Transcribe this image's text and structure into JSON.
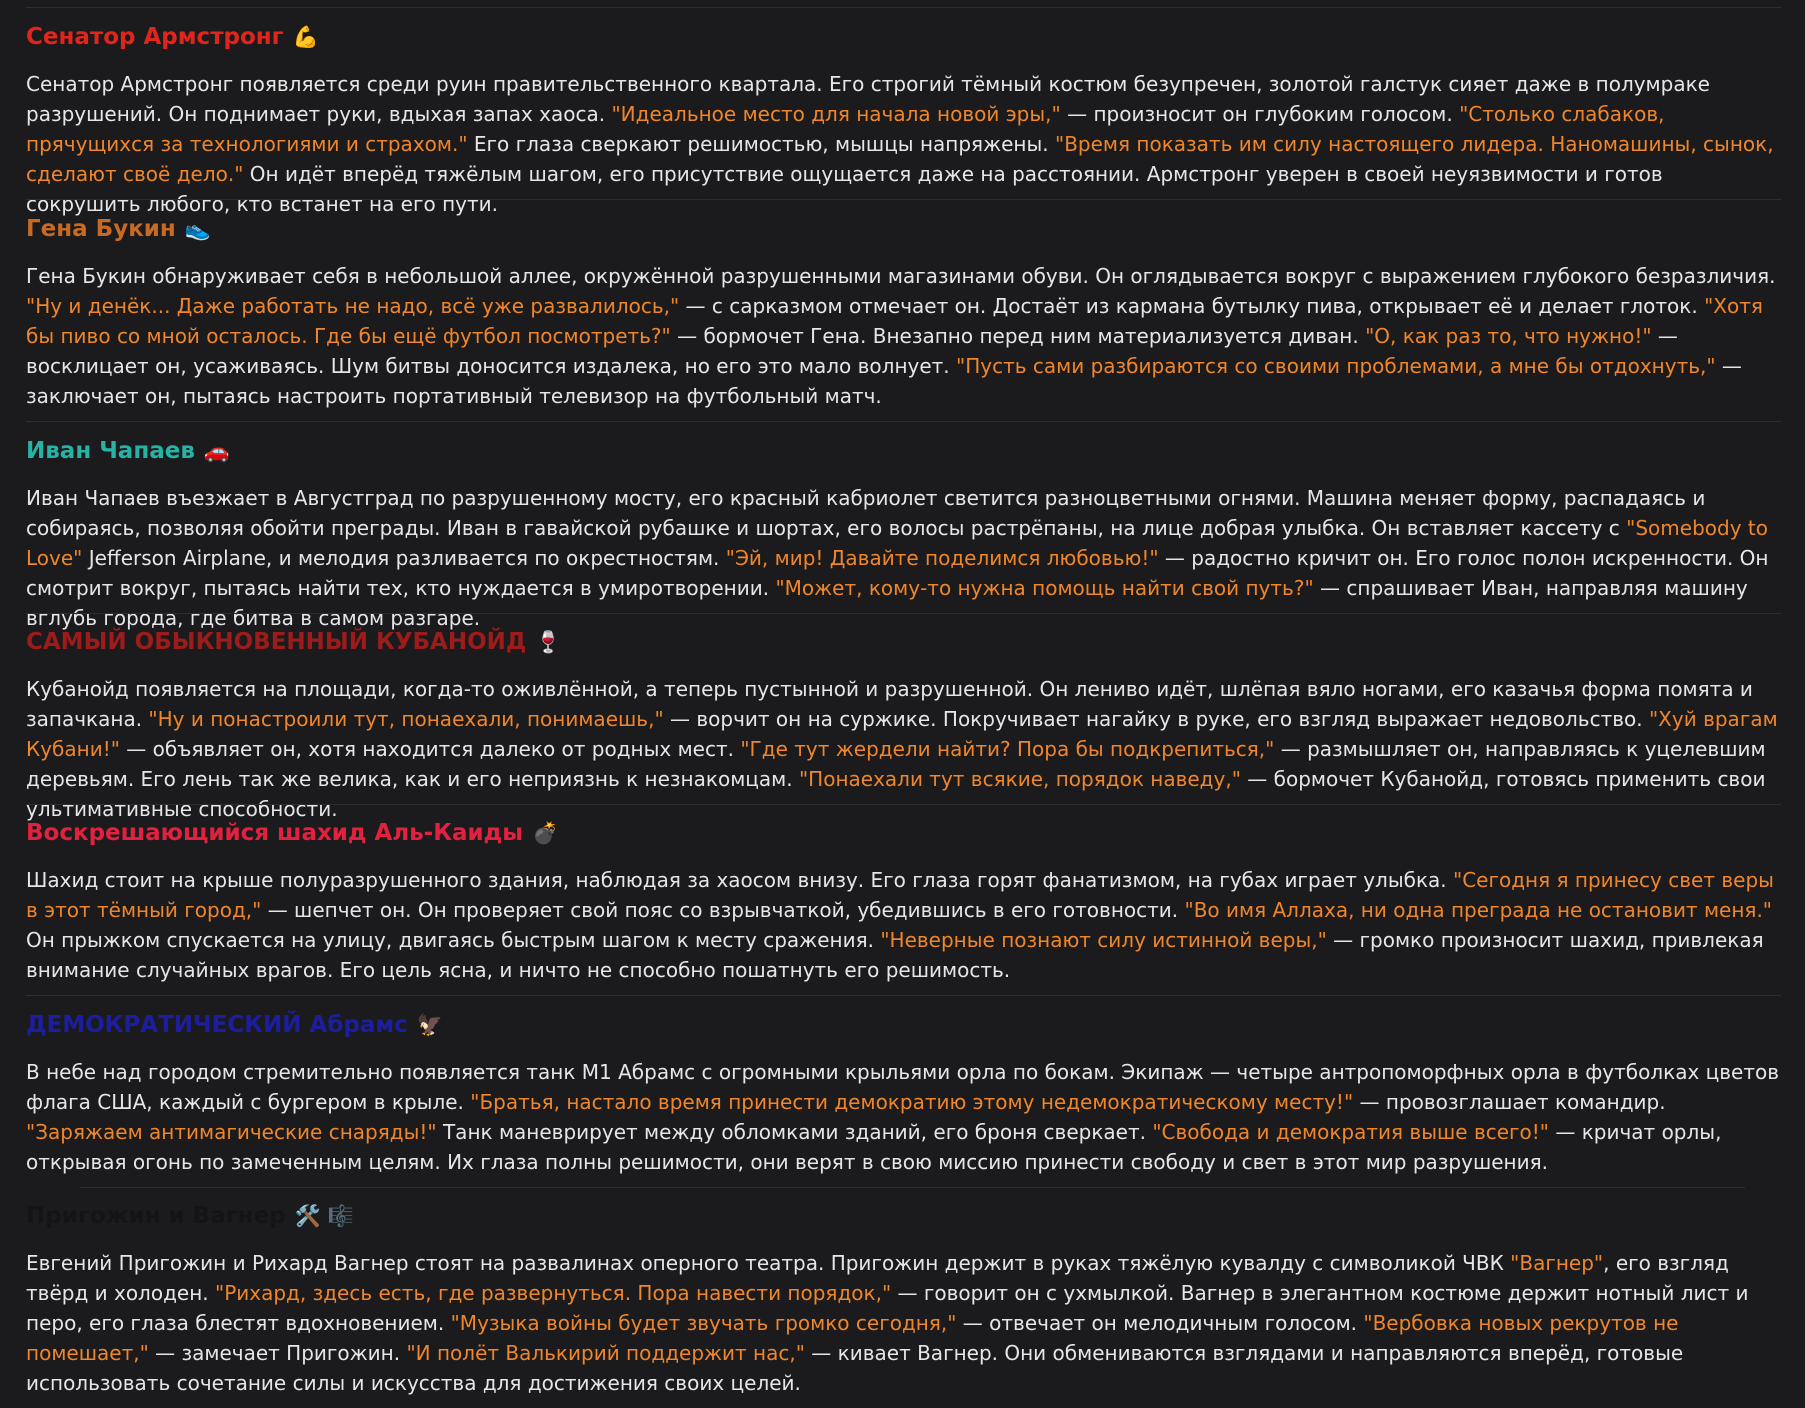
{
  "entries": [
    {
      "name": "Сенатор Армстронг",
      "emoji": "💪",
      "color": "#e0261c",
      "segments": [
        {
          "t": "Сенатор Армстронг появляется среди руин правительственного квартала. Его строгий тёмный костюм безупречен, золотой галстук сияет даже в полумраке разрушений. Он поднимает руки, вдыхая запах хаоса. "
        },
        {
          "t": "\"Идеальное место для начала новой эры,\"",
          "q": true
        },
        {
          "t": " — произносит он глубоким голосом. "
        },
        {
          "t": "\"Столько слабаков, прячущихся за технологиями и страхом.\"",
          "q": true
        },
        {
          "t": " Его глаза сверкают решимостью, мышцы напряжены. "
        },
        {
          "t": "\"Время показать им силу настоящего лидера. Наномашины, сынок, сделают своё дело.\"",
          "q": true
        },
        {
          "t": " Он идёт вперёд тяжёлым шагом, его присутствие ощущается даже на расстоянии. Армстронг уверен в своей неуязвимости и готов сокрушить любого, кто встанет на его пути."
        }
      ]
    },
    {
      "name": "Гена Букин",
      "emoji": "👟",
      "color": "#c66a24",
      "segments": [
        {
          "t": "Гена Букин обнаруживает себя в небольшой аллее, окружённой разрушенными магазинами обуви. Он оглядывается вокруг с выражением глубокого безразличия. "
        },
        {
          "t": "\"Ну и денёк... Даже работать не надо, всё уже развалилось,\"",
          "q": true
        },
        {
          "t": " — с сарказмом отмечает он. Достаёт из кармана бутылку пива, открывает её и делает глоток. "
        },
        {
          "t": "\"Хотя бы пиво со мной осталось. Где бы ещё футбол посмотреть?\"",
          "q": true
        },
        {
          "t": " — бормочет Гена. Внезапно перед ним материализуется диван. "
        },
        {
          "t": "\"О, как раз то, что нужно!\"",
          "q": true
        },
        {
          "t": " — восклицает он, усаживаясь. Шум битвы доносится издалека, но его это мало волнует. "
        },
        {
          "t": "\"Пусть сами разбираются со своими проблемами, а мне бы отдохнуть,\"",
          "q": true
        },
        {
          "t": " — заключает он, пытаясь настроить портативный телевизор на футбольный матч."
        }
      ]
    },
    {
      "name": "Иван Чапаев",
      "emoji": "🚗",
      "color": "#27b2a6",
      "segments": [
        {
          "t": "Иван Чапаев въезжает в Августград по разрушенному мосту, его красный кабриолет светится разноцветными огнями. Машина меняет форму, распадаясь и собираясь, позволяя обойти преграды. Иван в гавайской рубашке и шортах, его волосы растрёпаны, на лице добрая улыбка. Он вставляет кассету с "
        },
        {
          "t": "\"Somebody to Love\"",
          "q": true
        },
        {
          "t": " Jefferson Airplane, и мелодия разливается по окрестностям. "
        },
        {
          "t": "\"Эй, мир! Давайте поделимся любовью!\"",
          "q": true
        },
        {
          "t": " — радостно кричит он. Его голос полон искренности. Он смотрит вокруг, пытаясь найти тех, кто нуждается в умиротворении. "
        },
        {
          "t": "\"Может, кому-то нужна помощь найти свой путь?\"",
          "q": true
        },
        {
          "t": " — спрашивает Иван, направляя машину вглубь города, где битва в самом разгаре."
        }
      ]
    },
    {
      "name": "САМЫЙ ОБЫКНОВЕННЫЙ КУБАНОЙД",
      "emoji": "🍷",
      "color": "#9c1b1b",
      "segments": [
        {
          "t": "Кубанойд появляется на площади, когда-то оживлённой, а теперь пустынной и разрушенной. Он лениво идёт, шлёпая вяло ногами, его казачья форма помята и запачкана. "
        },
        {
          "t": "\"Ну и понастроили тут, понаехали, понимаешь,\"",
          "q": true
        },
        {
          "t": " — ворчит он на суржике. Покручивает нагайку в руке, его взгляд выражает недовольство. "
        },
        {
          "t": "\"Хуй врагам Кубани!\"",
          "q": true
        },
        {
          "t": " — объявляет он, хотя находится далеко от родных мест. "
        },
        {
          "t": "\"Где тут жердели найти? Пора бы подкрепиться,\"",
          "q": true
        },
        {
          "t": " — размышляет он, направляясь к уцелевшим деревьям. Его лень так же велика, как и его неприязнь к незнакомцам. "
        },
        {
          "t": "\"Понаехали тут всякие, порядок наведу,\"",
          "q": true
        },
        {
          "t": " — бормочет Кубанойд, готовясь применить свои ультимативные способности."
        }
      ]
    },
    {
      "name": "Воскрешающийся шахид Аль-Каиды",
      "emoji": "💣",
      "color": "#e3213f",
      "segments": [
        {
          "t": "Шахид стоит на крыше полуразрушенного здания, наблюдая за хаосом внизу. Его глаза горят фанатизмом, на губах играет улыбка. "
        },
        {
          "t": "\"Сегодня я принесу свет веры в этот тёмный город,\"",
          "q": true
        },
        {
          "t": " — шепчет он. Он проверяет свой пояс со взрывчаткой, убедившись в его готовности. "
        },
        {
          "t": "\"Во имя Аллаха, ни одна преграда не остановит меня.\"",
          "q": true
        },
        {
          "t": " Он прыжком спускается на улицу, двигаясь быстрым шагом к месту сражения. "
        },
        {
          "t": "\"Неверные познают силу истинной веры,\"",
          "q": true
        },
        {
          "t": " — громко произносит шахид, привлекая внимание случайных врагов. Его цель ясна, и ничто не способно пошатнуть его решимость."
        }
      ]
    },
    {
      "name": "ДЕМОКРАТИЧЕСКИЙ Абрамс",
      "emoji": "🦅",
      "color": "#1c1e9e",
      "segments": [
        {
          "t": "В небе над городом стремительно появляется танк M1 Абрамс с огромными крыльями орла по бокам. Экипаж — четыре антропоморфных орла в футболках цветов флага США, каждый с бургером в крыле. "
        },
        {
          "t": "\"Братья, настало время принести демократию этому недемократическому месту!\"",
          "q": true
        },
        {
          "t": " — провозглашает командир. "
        },
        {
          "t": "\"Заряжаем антимагические снаряды!\"",
          "q": true
        },
        {
          "t": " Танк маневрирует между обломками зданий, его броня сверкает. "
        },
        {
          "t": "\"Свобода и демократия выше всего!\"",
          "q": true
        },
        {
          "t": " — кричат орлы, открывая огонь по замеченным целям. Их глаза полны решимости, они верят в свою миссию принести свободу и свет в этот мир разрушения."
        }
      ]
    },
    {
      "name": "Пригожин и Вагнер",
      "emoji": "🛠️ 🎼",
      "color": "#141414",
      "segments": [
        {
          "t": "Евгений Пригожин и Рихард Вагнер стоят на развалинах оперного театра. Пригожин держит в руках тяжёлую кувалду с символикой ЧВК "
        },
        {
          "t": "\"Вагнер\"",
          "q": true
        },
        {
          "t": ", его взгляд твёрд и холоден. "
        },
        {
          "t": "\"Рихард, здесь есть, где развернуться. Пора навести порядок,\"",
          "q": true
        },
        {
          "t": " — говорит он с ухмылкой. Вагнер в элегантном костюме держит нотный лист и перо, его глаза блестят вдохновением. "
        },
        {
          "t": "\"Музыка войны будет звучать громко сегодня,\"",
          "q": true
        },
        {
          "t": " — отвечает он мелодичным голосом. "
        },
        {
          "t": "\"Вербовка новых рекрутов не помешает,\"",
          "q": true
        },
        {
          "t": " — замечает Пригожин. "
        },
        {
          "t": "\"И полёт Валькирий поддержит нас,\"",
          "q": true
        },
        {
          "t": " — кивает Вагнер. Они обмениваются взглядами и направляются вперёд, готовые использовать сочетание силы и искусства для достижения своих целей."
        }
      ]
    }
  ]
}
